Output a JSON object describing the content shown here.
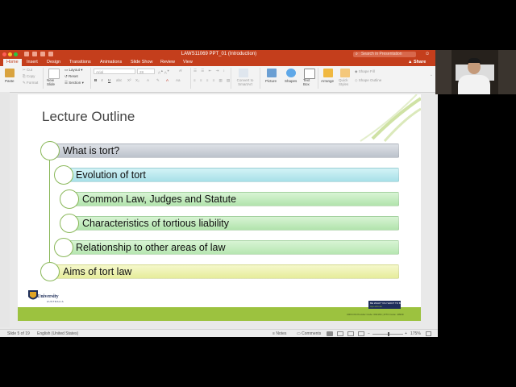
{
  "window": {
    "title": "LAWS11069 PPT_01 (Introduction)",
    "search_placeholder": "Search in Presentation",
    "share_label": "Share"
  },
  "tabs": [
    {
      "label": "Home",
      "active": true
    },
    {
      "label": "Insert"
    },
    {
      "label": "Design"
    },
    {
      "label": "Transitions"
    },
    {
      "label": "Animations"
    },
    {
      "label": "Slide Show"
    },
    {
      "label": "Review"
    },
    {
      "label": "View"
    }
  ],
  "ribbon": {
    "paste": "Paste",
    "cut": "Cut",
    "copy": "Copy",
    "format": "Format",
    "new_slide": "New Slide",
    "layout": "Layout",
    "reset": "Reset",
    "section": "Section",
    "font_name": "Arial",
    "font_size": "28",
    "convert_smartart": "Convert to SmartArt",
    "picture": "Picture",
    "shapes": "Shapes",
    "text_box": "Text Box",
    "arrange": "Arrange",
    "quick_styles": "Quick Styles",
    "shape_fill": "Shape Fill",
    "shape_outline": "Shape Outline"
  },
  "slide": {
    "title": "Lecture Outline",
    "items": [
      {
        "text": "What is tort?"
      },
      {
        "text": "Evolution of tort"
      },
      {
        "text": "Common Law, Judges and Statute"
      },
      {
        "text": "Characteristics of tortious liability"
      },
      {
        "text": "Relationship to other areas of law"
      },
      {
        "text": "Aims of tort law"
      }
    ],
    "logo_main": "University",
    "logo_sub": "AUSTRALIA",
    "promo_line1": "BE WHAT YOU WANT TO BE",
    "promo_line2": "cqu.edu.au",
    "cricos": "CRICOS Provider Code: 00219C | RTO Code: 40939"
  },
  "status": {
    "slide_counter": "Slide 5 of 19",
    "language": "English (United States)",
    "notes": "Notes",
    "comments": "Comments",
    "zoom": "175%"
  },
  "colors": {
    "accent": "#c43e1c",
    "slide_green": "#9cc23f",
    "row_gray": "#c9ced6",
    "row_teal": "#b8e8ee",
    "row_green": "#c2eac0",
    "row_yellow": "#eef2a8"
  }
}
